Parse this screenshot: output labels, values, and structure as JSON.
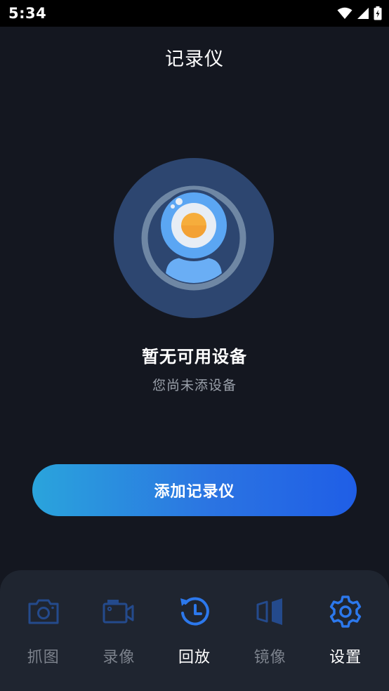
{
  "status_bar": {
    "time": "5:34"
  },
  "header": {
    "title": "记录仪"
  },
  "empty_state": {
    "title": "暂无可用设备",
    "subtitle": "您尚未添设备",
    "icon": "webcam-illustration"
  },
  "add_button": {
    "label": "添加记录仪"
  },
  "tab_bar": {
    "items": [
      {
        "label": "抓图",
        "icon": "camera-icon"
      },
      {
        "label": "录像",
        "icon": "video-camera-icon"
      },
      {
        "label": "回放",
        "icon": "playback-clock-icon"
      },
      {
        "label": "镜像",
        "icon": "mirror-icon"
      },
      {
        "label": "设置",
        "icon": "gear-icon"
      }
    ]
  },
  "colors": {
    "background": "#141720",
    "accent_blue": "#2b74e2",
    "icon_dim_blue": "#244a8c",
    "tab_bar_bg": "#1f2530"
  }
}
